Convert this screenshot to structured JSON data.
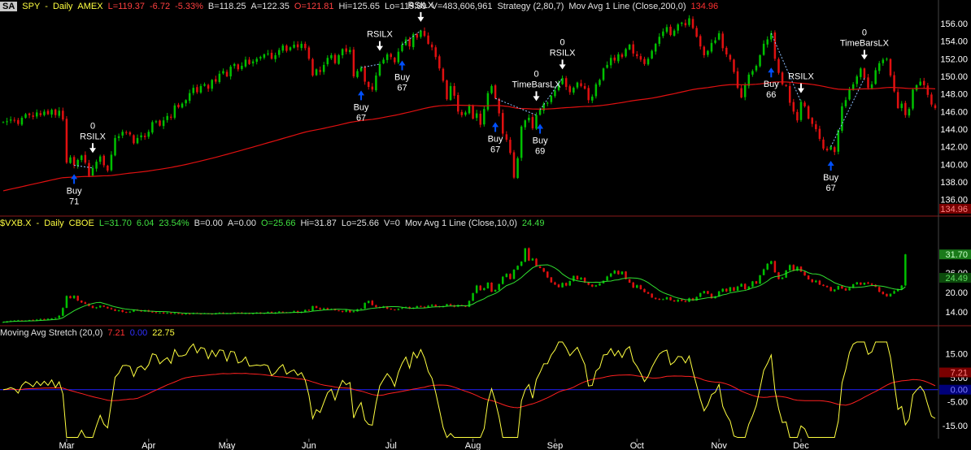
{
  "panes": {
    "price": {
      "symbol_box": "SA",
      "header": {
        "symbol": "SPY",
        "interval": "Daily",
        "exchange": "AMEX",
        "last": "L=119.37",
        "change": "-6.72",
        "change_pct": "-5.33%",
        "bid": "B=118.25",
        "ask": "A=122.35",
        "open": "O=121.81",
        "high": "Hi=125.65",
        "low": "Lo=119.89",
        "volume": "V=483,606,961",
        "strategy": "Strategy (2,80,7)",
        "indicator": "Mov Avg 1 Line (Close,200,0)",
        "indicator_value": "134.96"
      }
    },
    "vix": {
      "header": {
        "symbol": "$VXB.X",
        "interval": "Daily",
        "exchange": "CBOE",
        "last": "L=31.70",
        "change": "6.04",
        "change_pct": "23.54%",
        "bid": "B=0.00",
        "ask": "A=0.00",
        "open": "O=25.66",
        "high": "Hi=31.87",
        "low": "Lo=25.66",
        "volume": "V=0",
        "indicator": "Mov Avg 1 Line (Close,10,0)",
        "indicator_value": "24.49"
      }
    },
    "stretch": {
      "header": {
        "indicator": "Moving Avg Stretch (20,0)",
        "v1": "7.21",
        "v2": "0.00",
        "v3": "22.75"
      }
    }
  },
  "colors": {
    "background": "#000000",
    "up": "#00c000",
    "down": "#e01010",
    "ma_price": "#e01010",
    "ma_vix": "#30e030",
    "stretch_line": "#ffff40",
    "stretch_signal": "#ff2020",
    "zero_line": "#2020ff",
    "buy_arrow": "#0050ff",
    "exit_arrow": "#ffffff",
    "axis_text": "#ffffff",
    "separator": "#8a1a1a"
  },
  "chart_data": [
    {
      "type": "candlestick",
      "name": "SPY Daily",
      "x_labels": [
        "Mar",
        "Apr",
        "May",
        "Jun",
        "Jul",
        "Aug",
        "Sep",
        "Oct",
        "Nov",
        "Dec"
      ],
      "y_ticks": [
        "136.00",
        "138.00",
        "140.00",
        "142.00",
        "144.00",
        "146.00",
        "148.00",
        "150.00",
        "152.00",
        "154.00",
        "156.00"
      ],
      "ylim": [
        134.5,
        157.2
      ],
      "close": [
        144.8,
        144.9,
        145.1,
        145.0,
        144.6,
        145.3,
        145.7,
        145.6,
        145.4,
        145.9,
        145.6,
        146.0,
        145.7,
        146.2,
        145.6,
        146.1,
        145.1,
        140.2,
        140.8,
        139.9,
        140.5,
        141.0,
        140.2,
        138.7,
        139.6,
        140.3,
        140.9,
        139.9,
        139.3,
        141.1,
        143.0,
        143.2,
        143.7,
        143.6,
        143.4,
        142.4,
        143.0,
        143.3,
        143.1,
        143.7,
        144.8,
        144.9,
        144.4,
        145.0,
        145.5,
        145.3,
        146.7,
        146.5,
        146.9,
        147.3,
        148.1,
        148.7,
        148.2,
        148.9,
        149.1,
        148.6,
        149.6,
        149.4,
        150.3,
        150.6,
        150.0,
        151.1,
        151.4,
        150.8,
        151.2,
        151.9,
        151.4,
        151.7,
        152.0,
        152.2,
        152.5,
        152.6,
        152.0,
        152.4,
        153.0,
        153.5,
        152.9,
        153.3,
        153.6,
        153.3,
        153.7,
        153.2,
        152.0,
        150.1,
        150.8,
        150.5,
        151.3,
        152.1,
        152.4,
        151.5,
        152.4,
        153.1,
        152.8,
        153.0,
        150.0,
        150.6,
        151.0,
        149.4,
        148.8,
        148.5,
        150.1,
        151.4,
        151.9,
        152.5,
        152.2,
        151.6,
        152.8,
        153.6,
        154.2,
        153.4,
        154.8,
        154.4,
        155.2,
        154.6,
        153.7,
        153.3,
        152.2,
        150.9,
        149.5,
        147.4,
        148.9,
        147.8,
        146.0,
        145.6,
        145.9,
        146.7,
        145.2,
        145.8,
        144.5,
        146.3,
        148.1,
        148.9,
        147.5,
        145.8,
        143.5,
        142.8,
        141.3,
        138.5,
        140.7,
        144.3,
        145.0,
        145.3,
        144.1,
        145.6,
        146.2,
        146.9,
        147.0,
        147.8,
        148.4,
        149.2,
        149.8,
        148.8,
        148.2,
        148.7,
        149.3,
        148.9,
        148.6,
        147.3,
        147.7,
        149.1,
        149.6,
        150.9,
        151.3,
        152.1,
        151.8,
        152.5,
        152.2,
        153.1,
        153.6,
        152.6,
        152.3,
        151.9,
        151.4,
        152.0,
        152.9,
        153.7,
        154.5,
        155.1,
        155.6,
        154.7,
        155.2,
        155.9,
        156.1,
        155.8,
        156.6,
        155.5,
        154.5,
        153.4,
        152.4,
        152.9,
        153.8,
        154.1,
        154.9,
        153.2,
        152.5,
        151.9,
        150.5,
        148.7,
        147.6,
        149.0,
        150.2,
        150.6,
        151.2,
        152.4,
        153.7,
        154.2,
        154.9,
        152.0,
        150.4,
        149.1,
        148.9,
        147.0,
        146.0,
        145.0,
        147.1,
        146.6,
        145.2,
        144.6,
        144.0,
        142.9,
        141.8,
        141.6,
        142.0,
        141.4,
        143.9,
        146.6,
        147.3,
        148.5,
        149.1,
        150.0,
        150.9,
        149.8,
        148.7,
        149.1,
        150.7,
        151.5,
        151.9,
        152.0,
        150.1,
        148.3,
        146.4,
        146.9,
        145.6,
        146.3,
        148.5,
        149.0,
        149.4,
        149.0,
        147.9,
        146.8,
        146.4
      ],
      "ma200": "see close",
      "trades": [
        {
          "signal": "Buy",
          "size": "71",
          "exit": "RSILX",
          "exit_size": "0"
        },
        {
          "signal": "Buy",
          "size": "67",
          "exit": "RSILX",
          "exit_size": ""
        },
        {
          "signal": "Buy",
          "size": "67",
          "exit": "RSILX",
          "exit_size": "0"
        },
        {
          "signal": "Buy",
          "size": "67",
          "exit": "TimeBarsLX",
          "exit_size": "0"
        },
        {
          "signal": "Buy",
          "size": "69",
          "exit": "RSILX",
          "exit_size": "0"
        },
        {
          "signal": "Buy",
          "size": "66",
          "exit": "RSILX",
          "exit_size": ""
        },
        {
          "signal": "Buy",
          "size": "67",
          "exit": "TimeBarsLX",
          "exit_size": "0"
        }
      ],
      "last_labels": [
        "134.96"
      ]
    },
    {
      "type": "candlestick",
      "name": "$VXB.X Daily",
      "y_ticks": [
        "14.00",
        "20.00",
        "26.00"
      ],
      "ylim": [
        10.5,
        39.0
      ],
      "close": [
        10.9,
        11.0,
        11.2,
        11.3,
        11.4,
        11.2,
        11.3,
        11.5,
        11.4,
        11.6,
        11.8,
        11.7,
        11.9,
        12.0,
        12.2,
        12.8,
        15.2,
        18.9,
        18.2,
        19.0,
        17.5,
        16.9,
        16.5,
        15.8,
        15.2,
        15.4,
        15.9,
        15.6,
        15.1,
        14.8,
        14.3,
        14.5,
        14.0,
        13.8,
        14.1,
        14.6,
        14.4,
        14.2,
        14.5,
        14.1,
        13.9,
        13.7,
        13.8,
        13.6,
        13.7,
        13.5,
        13.6,
        13.4,
        13.3,
        13.5,
        13.4,
        13.6,
        13.5,
        13.4,
        13.6,
        13.5,
        13.3,
        13.5,
        13.7,
        13.4,
        13.6,
        13.5,
        13.8,
        13.7,
        13.5,
        13.6,
        13.4,
        13.6,
        13.8,
        13.5,
        13.7,
        13.9,
        13.6,
        13.8,
        14.1,
        13.9,
        13.7,
        13.9,
        14.2,
        13.8,
        14.0,
        14.6,
        14.4,
        15.8,
        15.2,
        14.8,
        15.1,
        14.7,
        14.9,
        14.5,
        14.3,
        14.0,
        14.6,
        13.9,
        14.2,
        14.8,
        15.0,
        16.8,
        17.4,
        16.1,
        15.5,
        15.2,
        15.7,
        15.0,
        14.8,
        14.6,
        14.9,
        15.2,
        15.5,
        15.1,
        15.3,
        15.8,
        15.6,
        15.4,
        15.9,
        16.2,
        15.7,
        15.5,
        15.8,
        16.4,
        16.0,
        15.6,
        16.1,
        15.9,
        15.6,
        17.4,
        19.8,
        22.1,
        20.7,
        21.3,
        23.0,
        20.2,
        20.8,
        22.6,
        24.8,
        25.7,
        24.1,
        27.0,
        28.2,
        29.5,
        33.6,
        29.8,
        30.4,
        28.0,
        27.5,
        26.4,
        24.6,
        23.1,
        22.4,
        21.6,
        22.9,
        22.1,
        23.5,
        25.1,
        24.0,
        24.5,
        23.0,
        22.4,
        21.8,
        22.2,
        22.8,
        23.6,
        24.9,
        25.8,
        26.7,
        25.6,
        26.4,
        24.1,
        23.0,
        21.5,
        22.2,
        21.0,
        20.1,
        19.6,
        18.4,
        18.0,
        17.8,
        17.9,
        18.5,
        17.6,
        17.2,
        17.8,
        17.4,
        17.1,
        18.2,
        17.5,
        18.6,
        19.8,
        20.4,
        19.6,
        18.2,
        18.7,
        20.3,
        21.1,
        20.3,
        21.6,
        20.5,
        21.8,
        22.6,
        21.0,
        21.8,
        23.4,
        22.7,
        25.3,
        27.1,
        28.8,
        29.6,
        26.2,
        24.1,
        24.6,
        26.8,
        28.4,
        26.7,
        27.9,
        26.4,
        25.2,
        24.0,
        23.2,
        23.6,
        22.4,
        22.0,
        21.6,
        20.4,
        20.9,
        22.0,
        21.2,
        20.6,
        21.4,
        22.5,
        23.1,
        22.4,
        23.0,
        22.7,
        22.3,
        21.7,
        20.2,
        19.5,
        18.8,
        19.6,
        20.4,
        21.0,
        22.1,
        31.7
      ],
      "last_labels": [
        "31.70",
        "24.49"
      ]
    },
    {
      "type": "line",
      "name": "Moving Avg Stretch (20,0)",
      "y_ticks": [
        "15.00",
        "5.00",
        "-5.00",
        "-15.00"
      ],
      "ylim": [
        -20.5,
        21.0
      ],
      "stretch_values": "derived from SPY close",
      "last_labels": [
        "7.21",
        "0.00"
      ]
    }
  ]
}
